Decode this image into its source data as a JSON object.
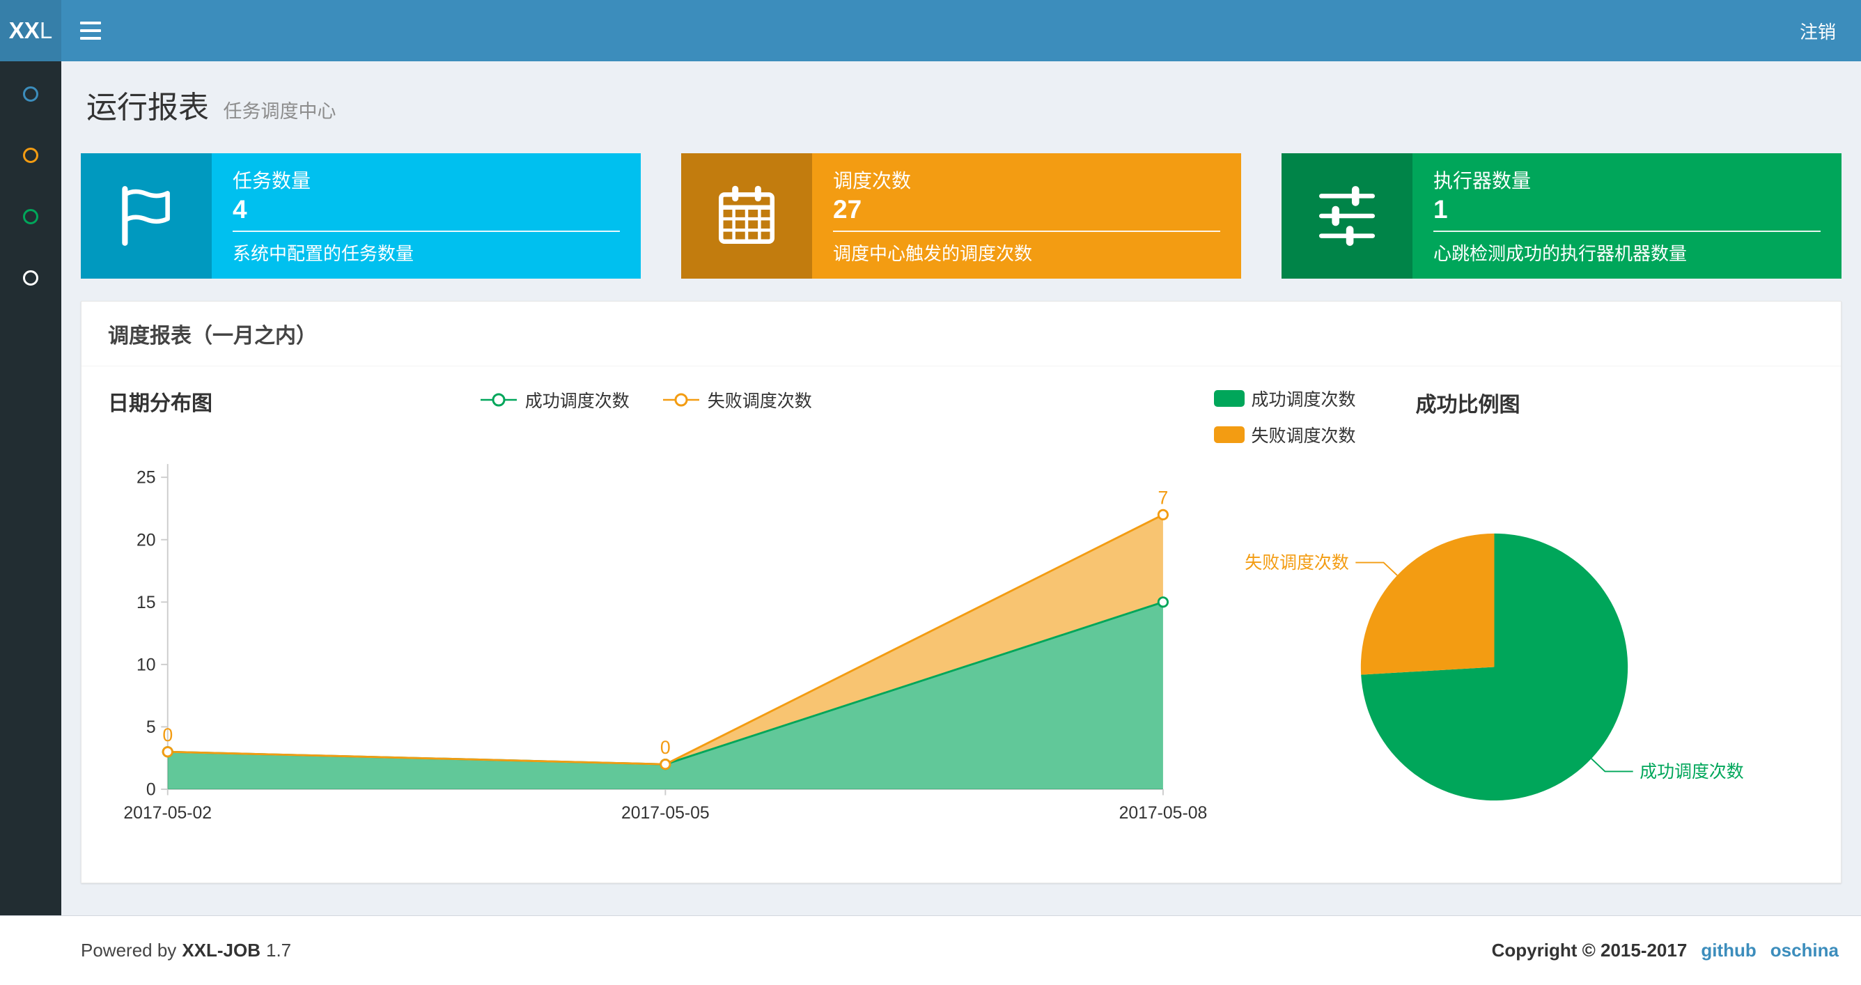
{
  "navbar": {
    "logo": {
      "bold": "XX",
      "light": "L"
    },
    "logout_label": "注销"
  },
  "sidebar": {
    "items": [
      {
        "id": "report",
        "color": "#3c8dbc"
      },
      {
        "id": "job",
        "color": "#f39c12"
      },
      {
        "id": "log",
        "color": "#00a65a"
      },
      {
        "id": "executor",
        "color": "#ffffff"
      }
    ]
  },
  "page_header": {
    "title": "运行报表",
    "subtitle": "任务调度中心"
  },
  "info_boxes": [
    {
      "title": "任务数量",
      "value": "4",
      "desc": "系统中配置的任务数量",
      "color": "#00c0ef",
      "icon": "flag-icon"
    },
    {
      "title": "调度次数",
      "value": "27",
      "desc": "调度中心触发的调度次数",
      "color": "#f39c12",
      "icon": "calendar-icon"
    },
    {
      "title": "执行器数量",
      "value": "1",
      "desc": "心跳检测成功的执行器机器数量",
      "color": "#00a65a",
      "icon": "sliders-icon"
    }
  ],
  "panel": {
    "title": "调度报表（一月之内）"
  },
  "chart_data": [
    {
      "type": "area",
      "title": "日期分布图",
      "stacked": true,
      "x": [
        "2017-05-02",
        "2017-05-05",
        "2017-05-08"
      ],
      "series": [
        {
          "name": "成功调度次数",
          "color": "#00A65A",
          "values": [
            3,
            2,
            15
          ]
        },
        {
          "name": "失败调度次数",
          "color": "#F39C12",
          "values": [
            0,
            0,
            7
          ],
          "point_labels": [
            "0",
            "0",
            "7"
          ]
        }
      ],
      "ylim": [
        0,
        25
      ],
      "yticks": [
        0,
        5,
        10,
        15,
        20,
        25
      ],
      "legend_position": "top-center",
      "grid": false
    },
    {
      "type": "pie",
      "title": "成功比例图",
      "slices": [
        {
          "name": "成功调度次数",
          "value": 20,
          "color": "#00A65A"
        },
        {
          "name": "失败调度次数",
          "value": 7,
          "color": "#F39C12"
        }
      ],
      "legend_position": "top-left"
    }
  ],
  "footer": {
    "powered_prefix": "Powered by",
    "product": "XXL-JOB",
    "version": "1.7",
    "copyright": "Copyright © 2015-2017",
    "links": [
      "github",
      "oschina"
    ]
  }
}
